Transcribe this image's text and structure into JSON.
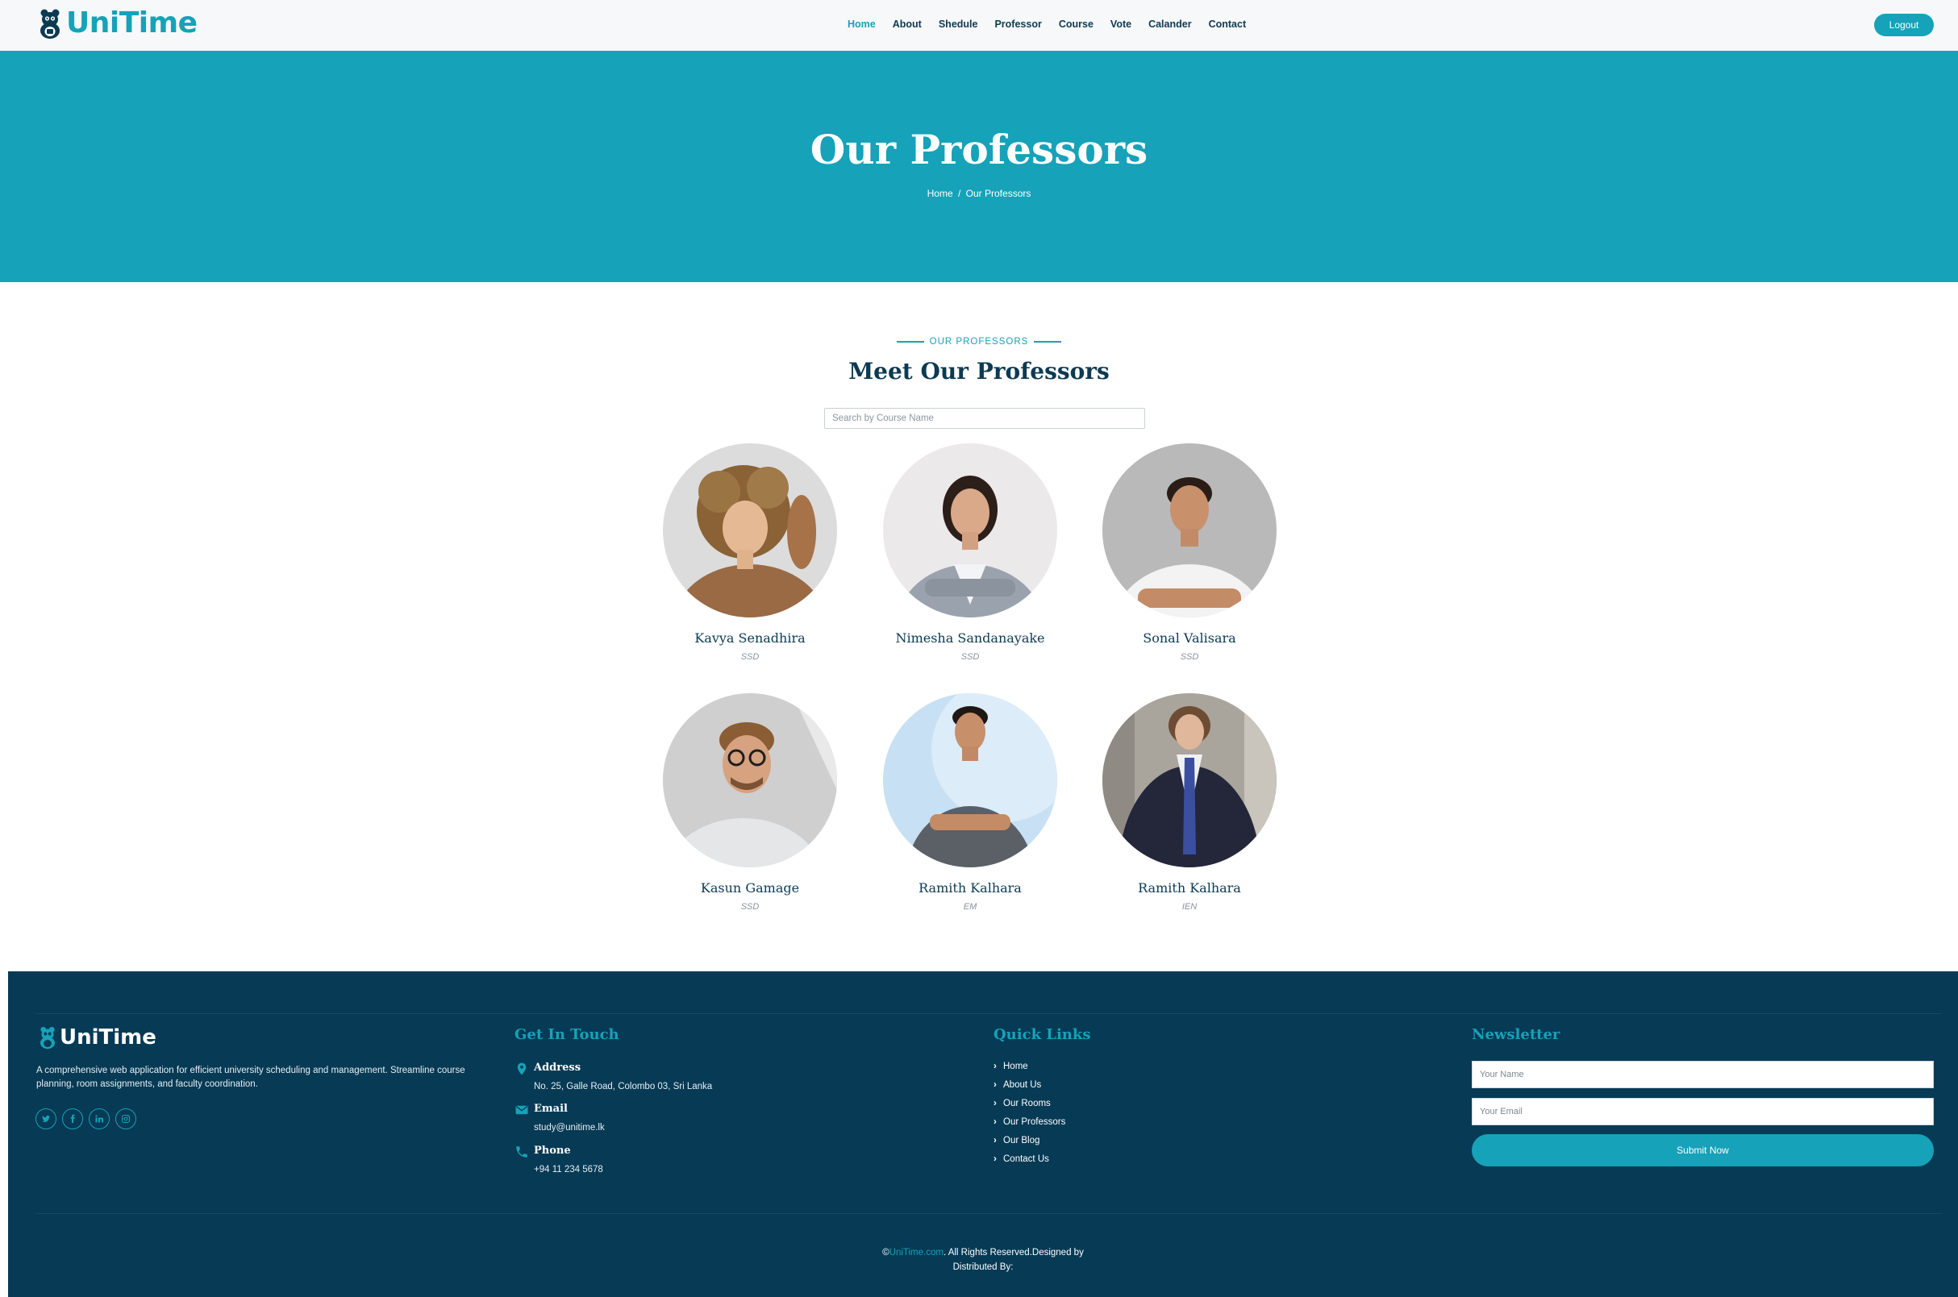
{
  "brand": {
    "name": "UniTime",
    "accent": "#16a2b8",
    "dark": "#063a55"
  },
  "nav": {
    "items": [
      "Home",
      "About",
      "Shedule",
      "Professor",
      "Course",
      "Vote",
      "Calander",
      "Contact"
    ],
    "active": "Home",
    "logout_label": "Logout"
  },
  "hero": {
    "title": "Our Professors",
    "breadcrumb": {
      "home": "Home",
      "separator": "/",
      "current": "Our Professors"
    }
  },
  "section": {
    "eyebrow": "OUR PROFESSORS",
    "title": "Meet Our Professors",
    "search_placeholder": "Search by Course Name"
  },
  "professors": [
    {
      "name": "Kavya Senadhira",
      "course": "SSD"
    },
    {
      "name": "Nimesha Sandanayake",
      "course": "SSD"
    },
    {
      "name": "Sonal Valisara",
      "course": "SSD"
    },
    {
      "name": "Kasun Gamage",
      "course": "SSD"
    },
    {
      "name": "Ramith Kalhara",
      "course": "EM"
    },
    {
      "name": "Ramith Kalhara",
      "course": "IEN"
    }
  ],
  "footer": {
    "brand": "UniTime",
    "description": "A comprehensive web application for efficient university scheduling and management. Streamline course planning, room assignments, and faculty coordination.",
    "socials": [
      "twitter-icon",
      "facebook-icon",
      "linkedin-icon",
      "instagram-icon"
    ],
    "contact": {
      "heading": "Get In Touch",
      "address_label": "Address",
      "address": "No. 25, Galle Road, Colombo 03, Sri Lanka",
      "email_label": "Email",
      "email": "study@unitime.lk",
      "phone_label": "Phone",
      "phone": "+94 11 234 5678"
    },
    "quick_links": {
      "heading": "Quick Links",
      "items": [
        "Home",
        "About Us",
        "Our Rooms",
        "Our Professors",
        "Our Blog",
        "Contact Us"
      ]
    },
    "newsletter": {
      "heading": "Newsletter",
      "name_placeholder": "Your Name",
      "email_placeholder": "Your Email",
      "submit_label": "Submit Now"
    },
    "copyright": {
      "prefix": "©",
      "site": "UniTime.com",
      "suffix": ". All Rights Reserved.Designed by",
      "line2": "Distributed By:"
    }
  }
}
